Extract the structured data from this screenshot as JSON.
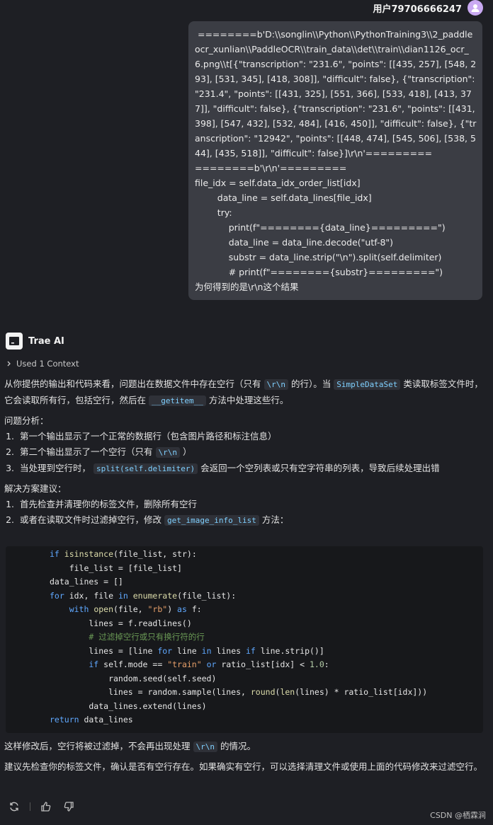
{
  "user": {
    "name": "用户79706666247",
    "message_lines": [
      " ========b'D:\\\\songlin\\\\Python\\\\PythonTraining3\\\\2_paddleocr_xunlian\\\\PaddleOCR\\\\train_data\\\\det\\\\train\\\\dian1126_ocr_6.png\\\\t[{\"transcription\": \"231.6\", \"points\": [[435, 257], [548, 293], [531, 345], [418, 308]], \"difficult\": false}, {\"transcription\": \"231.4\", \"points\": [[431, 325], [551, 366], [533, 418], [413, 377]], \"difficult\": false}, {\"transcription\": \"231.6\", \"points\": [[431, 398], [547, 432], [532, 484], [416, 450]], \"difficult\": false}, {\"transcription\": \"12942\", \"points\": [[448, 474], [545, 506], [538, 544], [435, 518]], \"difficult\": false}]\\r\\n'=========",
      "========b'\\r\\n'=========",
      "file_idx = self.data_idx_order_list[idx]",
      "        data_line = self.data_lines[file_idx]",
      "        try:",
      "            print(f\"========{data_line}=========\")",
      "            data_line = data_line.decode(\"utf-8\")",
      "            substr = data_line.strip(\"\\n\").split(self.delimiter)",
      "            # print(f\"========{substr}=========\")",
      "为何得到的是\\r\\n这个结果"
    ]
  },
  "assistant": {
    "name": "Trae AI",
    "context_label": "Used 1 Context",
    "intro_a": "从你提供的输出和代码来看，问题出在数据文件中存在空行（只有",
    "intro_code1": "\\r\\n",
    "intro_b": "的行）。当",
    "intro_code2": "SimpleDataSet",
    "intro_c": "类读取标签文件时，它会读取所有行，包括空行，然后在",
    "intro_code3": "__getitem__",
    "intro_d": "方法中处理这些行。",
    "analysis_title": "问题分析：",
    "analysis_1": "第一个输出显示了一个正常的数据行（包含图片路径和标注信息）",
    "analysis_2a": "第二个输出显示了一个空行（只有",
    "analysis_2_code": "\\r\\n",
    "analysis_2b": "）",
    "analysis_3a": "当处理到空行时，",
    "analysis_3_code": "split(self.delimiter)",
    "analysis_3b": "会返回一个空列表或只有空字符串的列表，导致后续处理出错",
    "solution_title": "解决方案建议：",
    "solution_1": "首先检查并清理你的标签文件，删除所有空行",
    "solution_2a": "或者在读取文件时过滤掉空行，修改",
    "solution_2_code": "get_image_info_list",
    "solution_2b": "方法：",
    "after_1a": "这样修改后，空行将被过滤掉，不会再出现处理",
    "after_1_code": "\\r\\n",
    "after_1b": "的情况。",
    "after_2": "建议先检查你的标签文件，确认是否有空行存在。如果确实有空行，可以选择清理文件或使用上面的代码修改来过滤空行。"
  },
  "code": {
    "l1_kw": "if",
    "l1_fn": "isinstance",
    "l1_rest": "(file_list, str):",
    "l2": "    file_list = [file_list]",
    "l3": "data_lines = []",
    "l4_kw": "for",
    "l4_a": " idx, file ",
    "l4_kw2": "in",
    "l4_fn": " enumerate",
    "l4_b": "(file_list):",
    "l5_kw": "    with",
    "l5_fn": " open",
    "l5_a": "(file, ",
    "l5_str": "\"rb\"",
    "l5_b": ") ",
    "l5_kw2": "as",
    "l5_c": " f:",
    "l6": "        lines = f.readlines()",
    "l7_cm": "        # 过滤掉空行或只有换行符的行",
    "l8_a": "        lines = [line ",
    "l8_kw": "for",
    "l8_b": " line ",
    "l8_kw2": "in",
    "l8_c": " lines ",
    "l8_kw3": "if",
    "l8_d": " line.strip()]",
    "l9_kw": "        if",
    "l9_a": " self.mode == ",
    "l9_str": "\"train\"",
    "l9_kw2": " or",
    "l9_b": " ratio_list[idx] < ",
    "l9_num": "1.0",
    "l9_c": ":",
    "l10": "            random.seed(self.seed)",
    "l11_a": "            lines = random.sample(lines, ",
    "l11_fn": "round",
    "l11_b": "(",
    "l11_fn2": "len",
    "l11_c": "(lines) * ratio_list[idx]))",
    "l12": "        data_lines.extend(lines)",
    "l13_kw": "return",
    "l13_a": " data_lines"
  },
  "watermark": "CSDN @栖霖涧",
  "icons": [
    "user-avatar-icon",
    "trae-logo-icon",
    "chevron-right-icon",
    "regenerate-icon",
    "thumbs-up-icon",
    "thumbs-down-icon"
  ]
}
